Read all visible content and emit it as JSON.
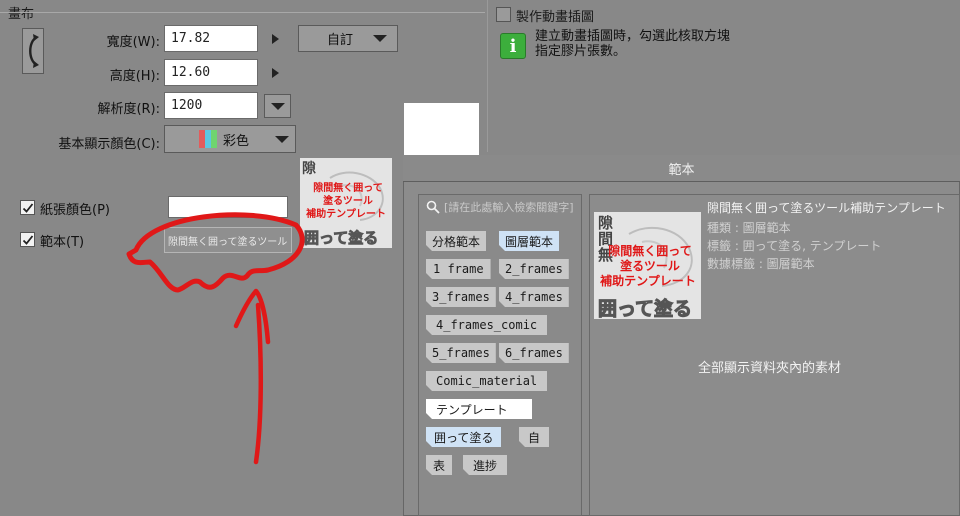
{
  "canvas": {
    "section_title": "畫布",
    "width_label": "寬度(W):",
    "width_value": "17.82",
    "preset_value": "自訂",
    "height_label": "高度(H):",
    "height_value": "12.60",
    "resolution_label": "解析度(R):",
    "resolution_value": "1200",
    "basic_color_label": "基本顯示顏色(C):",
    "basic_color_value": "彩色",
    "paper_color_label": "紙張顏色(P)",
    "template_label": "範本(T)",
    "template_value": "隙間無く囲って塗るツール"
  },
  "animation": {
    "checkbox_label": "製作動畫插圖",
    "info_text_1": "建立動畫插圖時，勾選此核取方塊",
    "info_text_2": "指定膠片張數。"
  },
  "template_panel": {
    "title": "範本",
    "search_placeholder": "[請在此處輸入檢索關鍵字]",
    "tags": [
      {
        "label": "分格範本"
      },
      {
        "label": "圖層範本"
      },
      {
        "label": "1 frame"
      },
      {
        "label": "2_frames"
      },
      {
        "label": "3_frames"
      },
      {
        "label": "4_frames"
      },
      {
        "label": "4_frames_comic"
      },
      {
        "label": "5_frames"
      },
      {
        "label": "6_frames"
      },
      {
        "label": "Comic_material"
      },
      {
        "label": "テンプレート"
      },
      {
        "label": "囲って塗る"
      },
      {
        "label": "自"
      },
      {
        "label": "表"
      },
      {
        "label": "進捗"
      }
    ],
    "selected": {
      "name": "隙間無く囲って塗るツール補助テンプレート",
      "kind": "種類 : 圖層範本",
      "tags": "標籤 : 囲って塗る, テンプレート",
      "data_tag": "數據標籤 : 圖層範本"
    },
    "show_all": "全部顯示資料夾內的素材"
  },
  "thumbnail": {
    "line1": "隙間無く囲って",
    "line2": "塗るツール",
    "line3": "補助テンプレート",
    "bottom": "囲って塗る",
    "top_char1": "隙",
    "top_char2": "間",
    "top_char3": "無"
  },
  "colors": {
    "accent_red": "#e01818",
    "info_green": "#3cae3c"
  }
}
